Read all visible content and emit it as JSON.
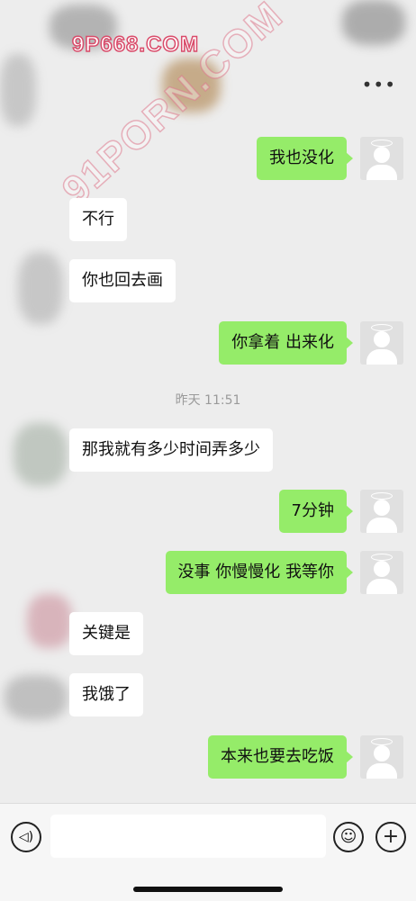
{
  "watermark": {
    "top": "9P668.COM",
    "diagonal": "91PORN.COM"
  },
  "header": {
    "more_icon": "ellipsis-icon",
    "more_label": "•••"
  },
  "messages": [
    {
      "side": "out",
      "text": "我也没化"
    },
    {
      "side": "in",
      "text": "不行"
    },
    {
      "side": "in",
      "text": "你也回去画"
    },
    {
      "side": "out",
      "text": "你拿着 出来化"
    },
    {
      "side": "in",
      "text": "那我就有多少时间弄多少"
    },
    {
      "side": "out",
      "text": "7分钟"
    },
    {
      "side": "out",
      "text": "没事 你慢慢化 我等你"
    },
    {
      "side": "in",
      "text": "关键是"
    },
    {
      "side": "in",
      "text": "我饿了"
    },
    {
      "side": "out",
      "text": "本来也要去吃饭"
    }
  ],
  "timestamp": "昨天 11:51",
  "input_bar": {
    "voice_icon": "voice-icon",
    "voice_glyph": "◁)",
    "text_value": "",
    "emoji_icon": "emoji-icon",
    "emoji_glyph": "☺",
    "add_icon": "plus-circle-icon",
    "add_glyph": "+"
  },
  "colors": {
    "outgoing_bubble": "#95ec69",
    "incoming_bubble": "#ffffff",
    "background": "#ededed"
  }
}
